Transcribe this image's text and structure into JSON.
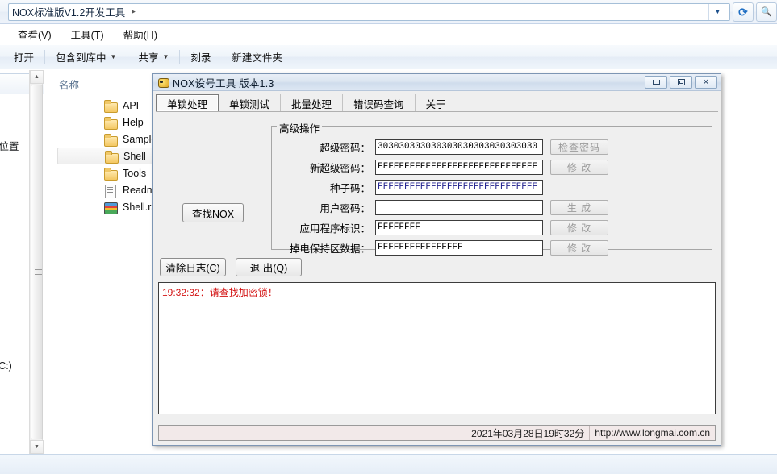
{
  "explorer": {
    "address": {
      "text": "NOX标准版V1.2开发工具",
      "crumb_arrow": "▸",
      "dropdown_icon": "▼"
    },
    "refresh_icon": "↻",
    "menus": [
      "查看(V)",
      "工具(T)",
      "帮助(H)"
    ],
    "commands": [
      {
        "label": "打开",
        "has_caret": false
      },
      {
        "label": "包含到库中",
        "has_caret": true
      },
      {
        "label": "共享",
        "has_caret": true
      },
      {
        "label": "刻录",
        "has_caret": false
      },
      {
        "label": "新建文件夹",
        "has_caret": false
      }
    ],
    "nav_fragment_texts": [
      "的位置",
      "(C:)"
    ],
    "list": {
      "column_header": "名称",
      "items": [
        {
          "name": "API",
          "icon": "folder-icon",
          "selected": false
        },
        {
          "name": "Help",
          "icon": "folder-icon",
          "selected": false
        },
        {
          "name": "Sample",
          "icon": "folder-icon",
          "selected": false
        },
        {
          "name": "Shell",
          "icon": "folder-icon",
          "selected": true
        },
        {
          "name": "Tools",
          "icon": "folder-icon",
          "selected": false
        },
        {
          "name": "Readme.txt",
          "icon": "text-file-icon",
          "selected": false
        },
        {
          "name": "Shell.rar",
          "icon": "archive-file-icon",
          "selected": false
        }
      ]
    }
  },
  "dialog": {
    "title": "NOX设号工具 版本1.3",
    "window_buttons": {
      "minimize": "—",
      "maximize": "▣",
      "close": "✕"
    },
    "tabs": [
      {
        "label": "单锁处理",
        "active": true
      },
      {
        "label": "单锁测试",
        "active": false
      },
      {
        "label": "批量处理",
        "active": false
      },
      {
        "label": "错误码查询",
        "active": false
      },
      {
        "label": "关于",
        "active": false
      }
    ],
    "find_button": "查找NOX",
    "group": {
      "legend": "高级操作",
      "fields": [
        {
          "label": "超级密码：",
          "value": "303030303030303030303030303030",
          "button": "检查密码",
          "button_enabled": false,
          "seed": false
        },
        {
          "label": "新超级密码：",
          "value": "FFFFFFFFFFFFFFFFFFFFFFFFFFFFFF",
          "button": "修  改",
          "button_enabled": false,
          "seed": false
        },
        {
          "label": "种子码：",
          "value": "FFFFFFFFFFFFFFFFFFFFFFFFFFFFFF",
          "button": "",
          "button_enabled": false,
          "seed": true
        },
        {
          "label": "用户密码：",
          "value": "",
          "button": "生  成",
          "button_enabled": false,
          "seed": false
        },
        {
          "label": "应用程序标识：",
          "value": "FFFFFFFF",
          "button": "修  改",
          "button_enabled": false,
          "seed": false
        },
        {
          "label": "掉电保持区数据：",
          "value": "FFFFFFFFFFFFFFFF",
          "button": "修  改",
          "button_enabled": false,
          "seed": false
        }
      ]
    },
    "buttons": {
      "clear_log": "清除日志(C)",
      "exit": "退  出(Q)"
    },
    "log": {
      "lines": [
        "19:32:32：请查找加密锁！"
      ],
      "color": "#d31212"
    },
    "status": {
      "datetime": "2021年03月28日19时32分",
      "url": "http://www.longmai.com.cn"
    }
  }
}
